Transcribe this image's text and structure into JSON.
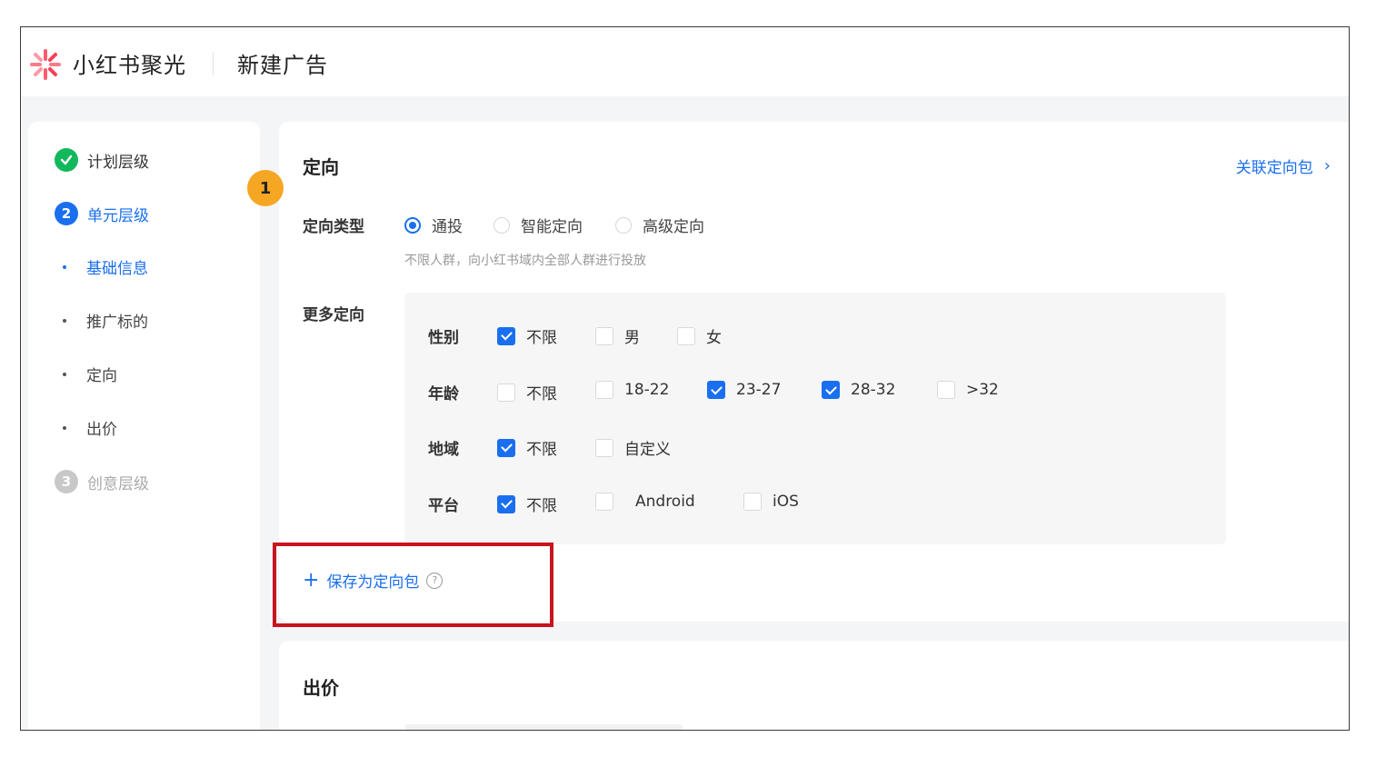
{
  "header": {
    "brand": "小红书聚光",
    "page_title": "新建广告"
  },
  "sidebar": {
    "steps": [
      {
        "num": "",
        "label": "计划层级",
        "state": "done"
      },
      {
        "num": "2",
        "label": "单元层级",
        "state": "active"
      },
      {
        "num": "3",
        "label": "创意层级",
        "state": "pending"
      }
    ],
    "subitems": [
      {
        "label": "基础信息",
        "active": true
      },
      {
        "label": "推广标的",
        "active": false
      },
      {
        "label": "定向",
        "active": false
      },
      {
        "label": "出价",
        "active": false
      }
    ]
  },
  "annotation_badge": "1",
  "targeting": {
    "title": "定向",
    "link_label": "关联定向包",
    "type_label": "定向类型",
    "type_options": [
      {
        "label": "通投",
        "selected": true
      },
      {
        "label": "智能定向",
        "selected": false
      },
      {
        "label": "高级定向",
        "selected": false
      }
    ],
    "hint": "不限人群，向小红书域内全部人群进行投放",
    "more_label": "更多定向",
    "rows": [
      {
        "label": "性别",
        "options": [
          {
            "label": "不限",
            "checked": true
          },
          {
            "label": "男",
            "checked": false
          },
          {
            "label": "女",
            "checked": false
          }
        ]
      },
      {
        "label": "年龄",
        "options": [
          {
            "label": "不限",
            "checked": false
          },
          {
            "label": "18-22",
            "checked": false
          },
          {
            "label": "23-27",
            "checked": true
          },
          {
            "label": "28-32",
            "checked": true
          },
          {
            "label": ">32",
            "checked": false
          }
        ]
      },
      {
        "label": "地域",
        "options": [
          {
            "label": "不限",
            "checked": true
          },
          {
            "label": "自定义",
            "checked": false
          }
        ]
      },
      {
        "label": "平台",
        "options": [
          {
            "label": "不限",
            "checked": true
          },
          {
            "label": "Android",
            "checked": false
          },
          {
            "label": "iOS",
            "checked": false
          }
        ]
      }
    ],
    "save_label": "保存为定向包",
    "help_icon": "?"
  },
  "bidding": {
    "title": "出价"
  },
  "colors": {
    "accent": "#1a6ff0",
    "success": "#12b85c",
    "badge": "#f5a623",
    "highlight": "#c8141e"
  }
}
